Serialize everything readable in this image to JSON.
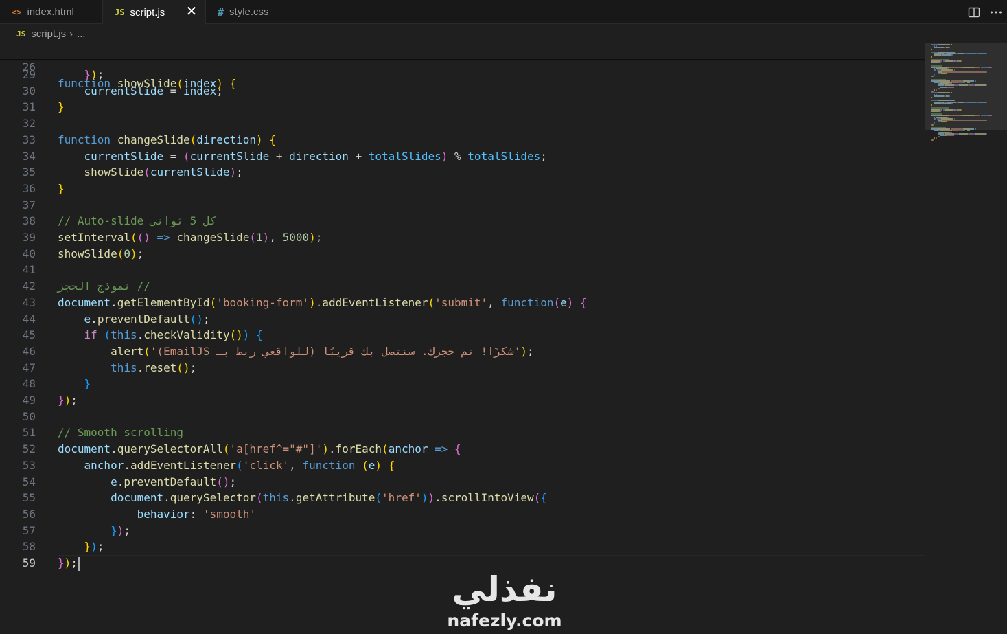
{
  "tabs": [
    {
      "label": "index.html",
      "icon": "html-brackets-icon",
      "icon_text": "<>",
      "color": "#e37933"
    },
    {
      "label": "script.js",
      "icon": "javascript-icon",
      "icon_text": "JS",
      "color": "#cbcb41",
      "active": true
    },
    {
      "label": "style.css",
      "icon": "css-hash-icon",
      "icon_text": "#",
      "color": "#519aba"
    }
  ],
  "tab_close": "✕",
  "breadcrumb": {
    "icon_text": "JS",
    "file": "script.js",
    "separator": "›",
    "more": "..."
  },
  "editor": {
    "sticky": {
      "number": "26",
      "segments": [
        [
          "kw",
          "function"
        ],
        [
          "op",
          " "
        ],
        [
          "fn",
          "showSlide"
        ],
        [
          "b1",
          "("
        ],
        [
          "vr",
          "index"
        ],
        [
          "b1",
          ")"
        ],
        [
          "op",
          " "
        ],
        [
          "b1",
          "{"
        ]
      ]
    },
    "current_line": "59",
    "lines": [
      {
        "n": "29",
        "g": [
          1
        ],
        "s": [
          [
            "op",
            "    "
          ],
          [
            "b2",
            "}"
          ],
          [
            "b1",
            ")"
          ],
          [
            "op",
            ";"
          ]
        ]
      },
      {
        "n": "30",
        "g": [
          1
        ],
        "s": [
          [
            "op",
            "    "
          ],
          [
            "vr",
            "currentSlide"
          ],
          [
            "op",
            " = "
          ],
          [
            "vr",
            "index"
          ],
          [
            "op",
            ";"
          ]
        ]
      },
      {
        "n": "31",
        "g": [],
        "s": [
          [
            "b1",
            "}"
          ]
        ]
      },
      {
        "n": "32",
        "g": [],
        "s": []
      },
      {
        "n": "33",
        "g": [],
        "s": [
          [
            "kw",
            "function"
          ],
          [
            "op",
            " "
          ],
          [
            "fn",
            "changeSlide"
          ],
          [
            "b1",
            "("
          ],
          [
            "vr",
            "direction"
          ],
          [
            "b1",
            ")"
          ],
          [
            "op",
            " "
          ],
          [
            "b1",
            "{"
          ]
        ]
      },
      {
        "n": "34",
        "g": [
          1
        ],
        "s": [
          [
            "op",
            "    "
          ],
          [
            "vr",
            "currentSlide"
          ],
          [
            "op",
            " = "
          ],
          [
            "b2",
            "("
          ],
          [
            "vr",
            "currentSlide"
          ],
          [
            "op",
            " + "
          ],
          [
            "vr",
            "direction"
          ],
          [
            "op",
            " + "
          ],
          [
            "cn",
            "totalSlides"
          ],
          [
            "b2",
            ")"
          ],
          [
            "op",
            " % "
          ],
          [
            "cn",
            "totalSlides"
          ],
          [
            "op",
            ";"
          ]
        ]
      },
      {
        "n": "35",
        "g": [
          1
        ],
        "s": [
          [
            "op",
            "    "
          ],
          [
            "fn",
            "showSlide"
          ],
          [
            "b2",
            "("
          ],
          [
            "vr",
            "currentSlide"
          ],
          [
            "b2",
            ")"
          ],
          [
            "op",
            ";"
          ]
        ]
      },
      {
        "n": "36",
        "g": [],
        "s": [
          [
            "b1",
            "}"
          ]
        ]
      },
      {
        "n": "37",
        "g": [],
        "s": []
      },
      {
        "n": "38",
        "g": [],
        "s": [
          [
            "cm",
            "// Auto-slide كل 5 ثواني"
          ]
        ]
      },
      {
        "n": "39",
        "g": [],
        "s": [
          [
            "fn",
            "setInterval"
          ],
          [
            "b1",
            "("
          ],
          [
            "b2",
            "()"
          ],
          [
            "op",
            " "
          ],
          [
            "kw",
            "=>"
          ],
          [
            "op",
            " "
          ],
          [
            "fn",
            "changeSlide"
          ],
          [
            "b2",
            "("
          ],
          [
            "nm",
            "1"
          ],
          [
            "b2",
            ")"
          ],
          [
            "op",
            ", "
          ],
          [
            "nm",
            "5000"
          ],
          [
            "b1",
            ")"
          ],
          [
            "op",
            ";"
          ]
        ]
      },
      {
        "n": "40",
        "g": [],
        "s": [
          [
            "fn",
            "showSlide"
          ],
          [
            "b1",
            "("
          ],
          [
            "nm",
            "0"
          ],
          [
            "b1",
            ")"
          ],
          [
            "op",
            ";"
          ]
        ]
      },
      {
        "n": "41",
        "g": [],
        "s": []
      },
      {
        "n": "42",
        "g": [],
        "s": [
          [
            "cm",
            "// نموذج الحجز"
          ]
        ]
      },
      {
        "n": "43",
        "g": [],
        "s": [
          [
            "vr",
            "document"
          ],
          [
            "op",
            "."
          ],
          [
            "fn",
            "getElementById"
          ],
          [
            "b1",
            "("
          ],
          [
            "st",
            "'booking-form'"
          ],
          [
            "b1",
            ")"
          ],
          [
            "op",
            "."
          ],
          [
            "fn",
            "addEventListener"
          ],
          [
            "b1",
            "("
          ],
          [
            "st",
            "'submit'"
          ],
          [
            "op",
            ", "
          ],
          [
            "kw",
            "function"
          ],
          [
            "b2",
            "("
          ],
          [
            "vr",
            "e"
          ],
          [
            "b2",
            ")"
          ],
          [
            "op",
            " "
          ],
          [
            "b2",
            "{"
          ]
        ]
      },
      {
        "n": "44",
        "g": [
          1
        ],
        "s": [
          [
            "op",
            "    "
          ],
          [
            "vr",
            "e"
          ],
          [
            "op",
            "."
          ],
          [
            "fn",
            "preventDefault"
          ],
          [
            "b3",
            "()"
          ],
          [
            "op",
            ";"
          ]
        ]
      },
      {
        "n": "45",
        "g": [
          1
        ],
        "s": [
          [
            "op",
            "    "
          ],
          [
            "ctl",
            "if"
          ],
          [
            "op",
            " "
          ],
          [
            "b3",
            "("
          ],
          [
            "kw",
            "this"
          ],
          [
            "op",
            "."
          ],
          [
            "fn",
            "checkValidity"
          ],
          [
            "b1",
            "()"
          ],
          [
            "b3",
            ")"
          ],
          [
            "op",
            " "
          ],
          [
            "b3",
            "{"
          ]
        ]
      },
      {
        "n": "46",
        "g": [
          1,
          2
        ],
        "s": [
          [
            "op",
            "        "
          ],
          [
            "fn",
            "alert"
          ],
          [
            "b1",
            "("
          ],
          [
            "st",
            "'شكرًا! تم حجزك. سنتصل بك قريبًا (للواقعي ربط بـ EmailJS)'"
          ],
          [
            "b1",
            ")"
          ],
          [
            "op",
            ";"
          ]
        ]
      },
      {
        "n": "47",
        "g": [
          1,
          2
        ],
        "s": [
          [
            "op",
            "        "
          ],
          [
            "kw",
            "this"
          ],
          [
            "op",
            "."
          ],
          [
            "fn",
            "reset"
          ],
          [
            "b1",
            "()"
          ],
          [
            "op",
            ";"
          ]
        ]
      },
      {
        "n": "48",
        "g": [
          1
        ],
        "s": [
          [
            "op",
            "    "
          ],
          [
            "b3",
            "}"
          ]
        ]
      },
      {
        "n": "49",
        "g": [],
        "s": [
          [
            "b2",
            "}"
          ],
          [
            "b1",
            ")"
          ],
          [
            "op",
            ";"
          ]
        ]
      },
      {
        "n": "50",
        "g": [],
        "s": []
      },
      {
        "n": "51",
        "g": [],
        "s": [
          [
            "cm",
            "// Smooth scrolling"
          ]
        ]
      },
      {
        "n": "52",
        "g": [],
        "s": [
          [
            "vr",
            "document"
          ],
          [
            "op",
            "."
          ],
          [
            "fn",
            "querySelectorAll"
          ],
          [
            "b1",
            "("
          ],
          [
            "st",
            "'a[href^=\"#\"]'"
          ],
          [
            "b1",
            ")"
          ],
          [
            "op",
            "."
          ],
          [
            "fn",
            "forEach"
          ],
          [
            "b1",
            "("
          ],
          [
            "vr",
            "anchor"
          ],
          [
            "op",
            " "
          ],
          [
            "kw",
            "=>"
          ],
          [
            "op",
            " "
          ],
          [
            "b2",
            "{"
          ]
        ]
      },
      {
        "n": "53",
        "g": [
          1
        ],
        "s": [
          [
            "op",
            "    "
          ],
          [
            "vr",
            "anchor"
          ],
          [
            "op",
            "."
          ],
          [
            "fn",
            "addEventListener"
          ],
          [
            "b3",
            "("
          ],
          [
            "st",
            "'click'"
          ],
          [
            "op",
            ", "
          ],
          [
            "kw",
            "function"
          ],
          [
            "op",
            " "
          ],
          [
            "b1",
            "("
          ],
          [
            "vr",
            "e"
          ],
          [
            "b1",
            ")"
          ],
          [
            "op",
            " "
          ],
          [
            "b1",
            "{"
          ]
        ]
      },
      {
        "n": "54",
        "g": [
          1,
          2
        ],
        "s": [
          [
            "op",
            "        "
          ],
          [
            "vr",
            "e"
          ],
          [
            "op",
            "."
          ],
          [
            "fn",
            "preventDefault"
          ],
          [
            "b2",
            "()"
          ],
          [
            "op",
            ";"
          ]
        ]
      },
      {
        "n": "55",
        "g": [
          1,
          2
        ],
        "s": [
          [
            "op",
            "        "
          ],
          [
            "vr",
            "document"
          ],
          [
            "op",
            "."
          ],
          [
            "fn",
            "querySelector"
          ],
          [
            "b2",
            "("
          ],
          [
            "kw",
            "this"
          ],
          [
            "op",
            "."
          ],
          [
            "fn",
            "getAttribute"
          ],
          [
            "b3",
            "("
          ],
          [
            "st",
            "'href'"
          ],
          [
            "b3",
            ")"
          ],
          [
            "b2",
            ")"
          ],
          [
            "op",
            "."
          ],
          [
            "fn",
            "scrollIntoView"
          ],
          [
            "b2",
            "("
          ],
          [
            "b3",
            "{"
          ]
        ]
      },
      {
        "n": "56",
        "g": [
          1,
          2,
          3
        ],
        "s": [
          [
            "op",
            "            "
          ],
          [
            "vr",
            "behavior"
          ],
          [
            "op",
            ": "
          ],
          [
            "st",
            "'smooth'"
          ]
        ]
      },
      {
        "n": "57",
        "g": [
          1,
          2
        ],
        "s": [
          [
            "op",
            "        "
          ],
          [
            "b3",
            "}"
          ],
          [
            "b2",
            ")"
          ],
          [
            "op",
            ";"
          ]
        ]
      },
      {
        "n": "58",
        "g": [
          1
        ],
        "s": [
          [
            "op",
            "    "
          ],
          [
            "b1",
            "}"
          ],
          [
            "b3",
            ")"
          ],
          [
            "op",
            ";"
          ]
        ]
      },
      {
        "n": "59",
        "g": [],
        "s": [
          [
            "b2",
            "}"
          ],
          [
            "b1",
            ")"
          ],
          [
            "op",
            ";"
          ]
        ]
      }
    ]
  },
  "watermark": {
    "arabic": "نفذلي",
    "latin": "nafezly.com"
  }
}
